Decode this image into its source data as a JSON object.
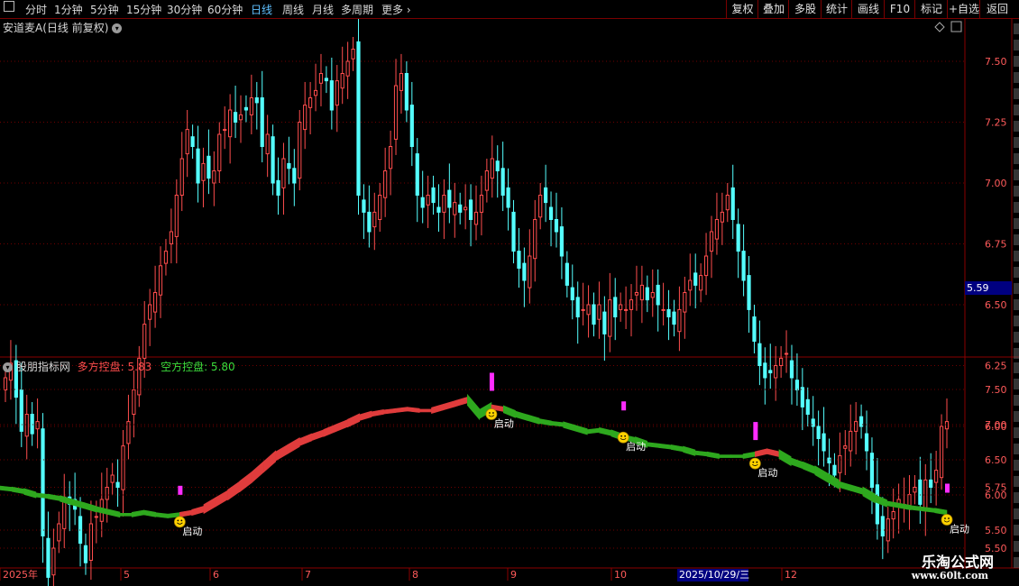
{
  "toolbar": {
    "periods": [
      "分时",
      "1分钟",
      "5分钟",
      "15分钟",
      "30分钟",
      "60分钟",
      "日线",
      "周线",
      "月线",
      "多周期",
      "更多"
    ],
    "active_period": "日线",
    "right_buttons": [
      "复权",
      "叠加",
      "多股",
      "统计",
      "画线",
      "F10",
      "标记",
      "+自选",
      "返回"
    ]
  },
  "main_chart": {
    "title": "安道麦A(日线 前复权)",
    "price_axis": [
      "7.50",
      "7.25",
      "7.00",
      "6.75",
      "6.50",
      "6.25",
      "6.00",
      "5.75",
      "5.50"
    ],
    "current_price": "5.59"
  },
  "indicator": {
    "name": "股朋指标网",
    "bull_label": "多方控盘: 5.83",
    "bear_label": "空方控盘: 5.80",
    "axis": [
      "7.50",
      "7.00",
      "6.50",
      "6.00",
      "5.50"
    ],
    "signal_text": "启动"
  },
  "date_axis": {
    "labels": [
      "2025年",
      "5",
      "6",
      "7",
      "8",
      "9",
      "10",
      "12"
    ],
    "cursor_date": "2025/10/29/三"
  },
  "watermark": {
    "name": "乐淘公式网",
    "url": "www.60lt.com"
  },
  "colors": {
    "up": "#ff4d4d",
    "down": "#54ffff",
    "bull_band": "#e03c3c",
    "bear_band": "#2ea81e",
    "signal": "#ff2cff",
    "grid": "#6e0000"
  },
  "chart_data": {
    "type": "candlestick",
    "ylim": [
      5.25,
      7.75
    ],
    "close": [
      6.2,
      6.26,
      6.12,
      5.98,
      6.05,
      5.97,
      6.02,
      5.55,
      5.38,
      5.5,
      5.6,
      5.71,
      5.68,
      5.66,
      5.52,
      5.44,
      5.6,
      5.63,
      5.7,
      5.75,
      5.8,
      5.75,
      5.92,
      6.02,
      6.15,
      6.28,
      6.42,
      6.5,
      6.55,
      6.66,
      6.72,
      6.8,
      6.95,
      7.1,
      7.22,
      7.15,
      7.0,
      7.08,
      7.02,
      7.05,
      7.2,
      7.22,
      7.3,
      7.25,
      7.28,
      7.3,
      7.35,
      7.33,
      7.15,
      7.2,
      7.0,
      6.95,
      7.1,
      7.06,
      7.0,
      7.25,
      7.32,
      7.35,
      7.38,
      7.45,
      7.42,
      7.3,
      7.42,
      7.45,
      7.5,
      7.55,
      6.95,
      6.88,
      6.8,
      6.88,
      6.95,
      7.05,
      7.15,
      7.4,
      7.45,
      7.3,
      7.15,
      6.95,
      6.9,
      6.95,
      6.92,
      6.88,
      6.95,
      6.9,
      6.92,
      6.88,
      6.9,
      6.85,
      6.88,
      6.95,
      7.05,
      7.1,
      7.05,
      6.95,
      6.9,
      6.72,
      6.65,
      6.6,
      6.7,
      6.85,
      6.95,
      6.92,
      6.85,
      6.8,
      6.7,
      6.58,
      6.52,
      6.45,
      6.48,
      6.5,
      6.42,
      6.5,
      6.38,
      6.52,
      6.45,
      6.5,
      6.48,
      6.52,
      6.55,
      6.58,
      6.52,
      6.55,
      6.5,
      6.48,
      6.45,
      6.42,
      6.48,
      6.55,
      6.6,
      6.58,
      6.62,
      6.7,
      6.8,
      6.85,
      6.88,
      6.95,
      6.85,
      6.72,
      6.6,
      6.48,
      6.35,
      6.25,
      6.2,
      6.22,
      6.25,
      6.28,
      6.3,
      6.2,
      6.15,
      6.08,
      6.05,
      6.0,
      5.95,
      5.9,
      5.85,
      5.8,
      5.88,
      5.92,
      5.98,
      6.02,
      6.0,
      5.9,
      5.75,
      5.6,
      5.55,
      5.62,
      5.65,
      5.7,
      5.68,
      5.72,
      5.75,
      5.68,
      5.78,
      5.75,
      5.82,
      6.0,
      6.02
    ],
    "indicator_points": [
      6.1,
      6.08,
      6.05,
      6.0,
      5.98,
      5.95,
      5.9,
      5.85,
      5.8,
      5.76,
      5.72,
      5.72,
      5.75,
      5.72,
      5.7,
      5.72,
      5.75,
      5.8,
      5.9,
      6.0,
      6.12,
      6.25,
      6.4,
      6.55,
      6.65,
      6.75,
      6.82,
      6.88,
      6.95,
      7.02,
      7.1,
      7.15,
      7.18,
      7.2,
      7.22,
      7.2,
      7.2,
      7.25,
      7.3,
      7.35,
      7.15,
      7.25,
      7.22,
      7.15,
      7.1,
      7.05,
      7.02,
      7.0,
      6.95,
      6.9,
      6.92,
      6.88,
      6.82,
      6.78,
      6.72,
      6.7,
      6.68,
      6.65,
      6.6,
      6.58,
      6.55,
      6.55,
      6.55,
      6.58,
      6.62,
      6.58,
      6.48,
      6.42,
      6.35,
      6.25,
      6.15,
      6.1,
      6.05,
      5.95,
      5.88,
      5.85,
      5.82,
      5.8,
      5.78,
      5.75
    ],
    "bull_segments": [
      [
        15,
        39
      ],
      [
        41,
        42
      ],
      [
        63,
        65
      ]
    ],
    "signals": [
      {
        "index": 15,
        "value": 5.72
      },
      {
        "index": 41,
        "value": 7.25
      },
      {
        "index": 52,
        "value": 6.92
      },
      {
        "index": 63,
        "value": 6.55
      },
      {
        "index": 79,
        "value": 5.75
      }
    ]
  }
}
